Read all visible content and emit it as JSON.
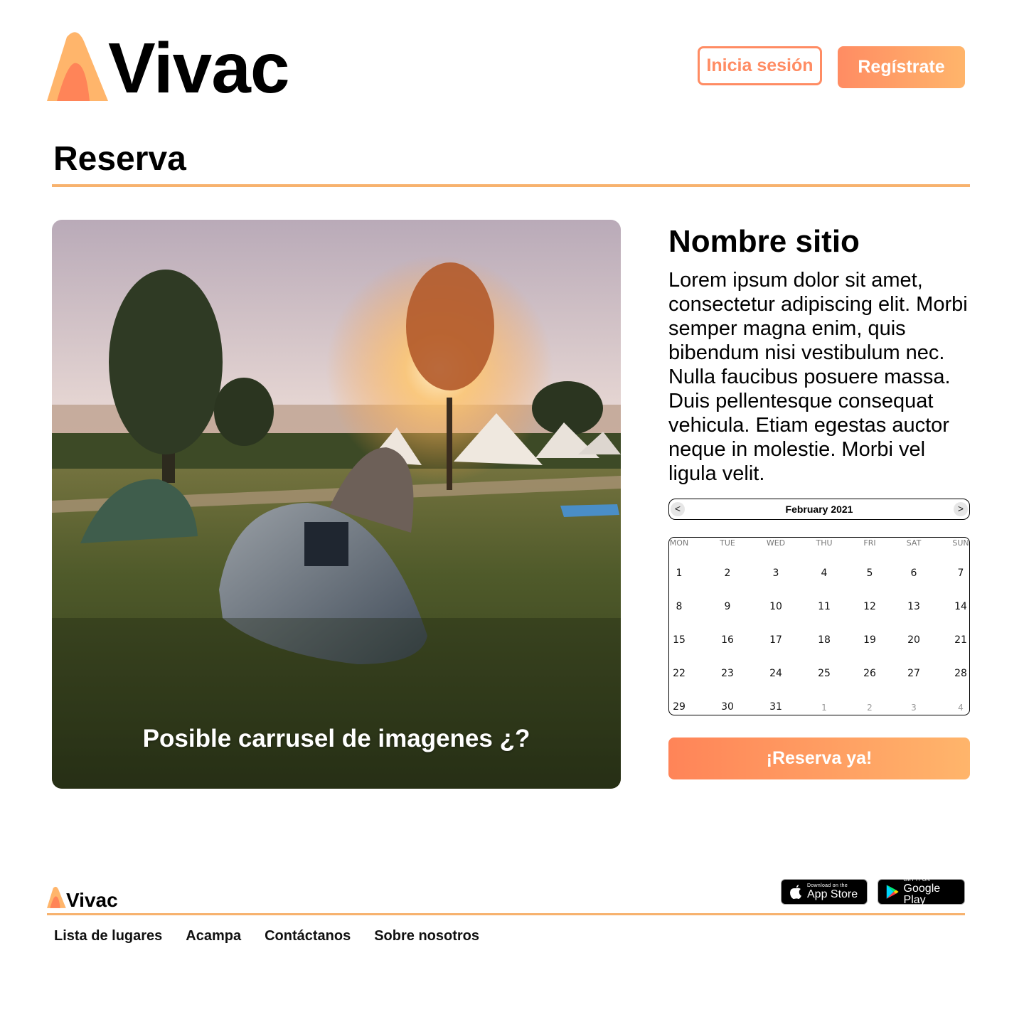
{
  "brand": {
    "name": "Vivac"
  },
  "header": {
    "login_label": "Inicia sesión",
    "register_label": "Regístrate"
  },
  "page": {
    "title": "Reserva"
  },
  "gallery": {
    "caption": "Posible carrusel de imagenes ¿?"
  },
  "site": {
    "name": "Nombre sitio",
    "description": "Lorem ipsum dolor sit amet, consectetur adipiscing elit. Morbi semper magna enim, quis bibendum nisi vestibulum nec. Nulla faucibus posuere massa. Duis pellentesque consequat vehicula. Etiam egestas auctor neque in molestie. Morbi vel ligula velit."
  },
  "calendar": {
    "month_label": "February 2021",
    "prev_label": "<",
    "next_label": ">",
    "weekdays": [
      "MON",
      "TUE",
      "WED",
      "THU",
      "FRI",
      "SAT",
      "SUN"
    ],
    "weeks": [
      [
        "1",
        "2",
        "3",
        "4",
        "5",
        "6",
        "7"
      ],
      [
        "8",
        "9",
        "10",
        "11",
        "12",
        "13",
        "14"
      ],
      [
        "15",
        "16",
        "17",
        "18",
        "19",
        "20",
        "21"
      ],
      [
        "22",
        "23",
        "24",
        "25",
        "26",
        "27",
        "28"
      ],
      [
        "29",
        "30",
        "31",
        "1",
        "2",
        "3",
        "4"
      ]
    ],
    "next_month_days_in_last_week": 4
  },
  "reserve_button": {
    "label": "¡Reserva ya!"
  },
  "footer": {
    "brand": "Vivac",
    "links": [
      "Lista de lugares",
      "Acampa",
      "Contáctanos",
      "Sobre nosotros"
    ],
    "app_store": {
      "small": "Download on the",
      "big": "App Store"
    },
    "google_play": {
      "small": "GET IT ON",
      "big": "Google Play"
    }
  },
  "colors": {
    "accent": "#ff8c63",
    "accent_light": "#ffb56b",
    "rule": "#f7b26e"
  }
}
